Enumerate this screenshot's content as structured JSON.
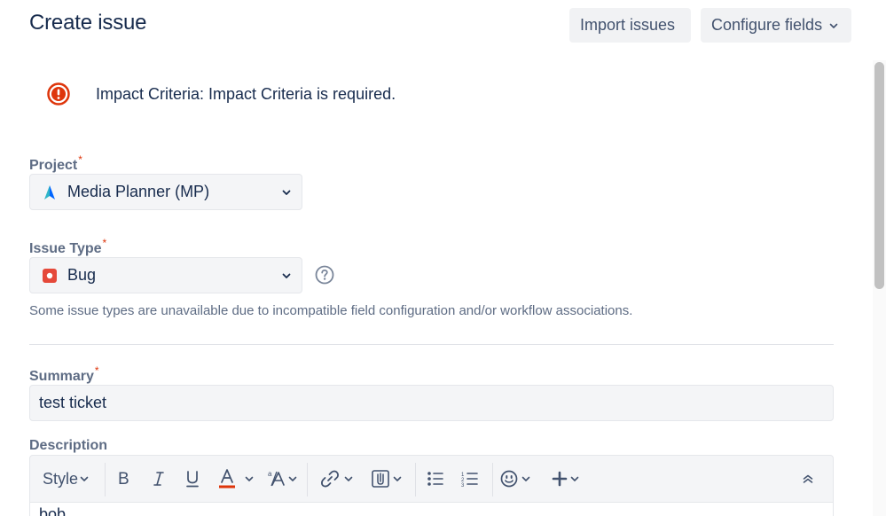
{
  "header": {
    "title": "Create issue",
    "import_label": "Import issues",
    "configure_label": "Configure fields"
  },
  "error": {
    "message": "Impact Criteria: Impact Criteria is required."
  },
  "fields": {
    "project": {
      "label": "Project",
      "required_mark": "*",
      "value": "Media Planner (MP)",
      "icon": "project-icon"
    },
    "issue_type": {
      "label": "Issue Type",
      "required_mark": "*",
      "value": "Bug",
      "icon": "bug-icon",
      "hint": "Some issue types are unavailable due to incompatible field configuration and/or workflow associations."
    },
    "summary": {
      "label": "Summary",
      "required_mark": "*",
      "value": "test ticket"
    },
    "description": {
      "label": "Description",
      "style_label": "Style",
      "content_preview": "bob"
    }
  },
  "colors": {
    "error": "#de350b",
    "bug": "#e5493a",
    "project": "#0065ff",
    "text_color_underline": "#de350b"
  }
}
